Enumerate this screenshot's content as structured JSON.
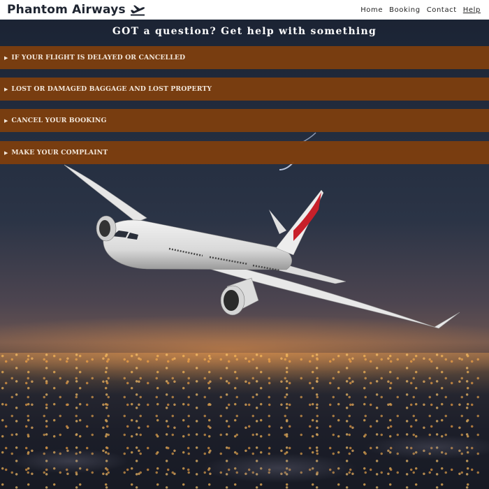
{
  "header": {
    "brand_title": "Phantom Airways",
    "brand_icon": "airplane-departure-icon",
    "nav": [
      {
        "label": "Home",
        "active": false
      },
      {
        "label": "Booking",
        "active": false
      },
      {
        "label": "Contact",
        "active": false
      },
      {
        "label": "Help",
        "active": true
      }
    ]
  },
  "main": {
    "heading": "GOT a question? Get help with something",
    "faq": [
      {
        "label": "IF YOUR FLIGHT IS DELAYED OR CANCELLED",
        "marker": "▶"
      },
      {
        "label": "LOST OR DAMAGED BAGGAGE AND LOST PROPERTY",
        "marker": "▶"
      },
      {
        "label": "CANCEL YOUR BOOKING",
        "marker": "▶"
      },
      {
        "label": "MAKE YOUR COMPLAINT",
        "marker": "▶"
      }
    ]
  },
  "colors": {
    "accordion_bg": "#7d3e0e",
    "navbar_bg": "#ffffff",
    "brand_text": "#1e2430"
  },
  "background": {
    "image": "airplane-over-night-city"
  }
}
